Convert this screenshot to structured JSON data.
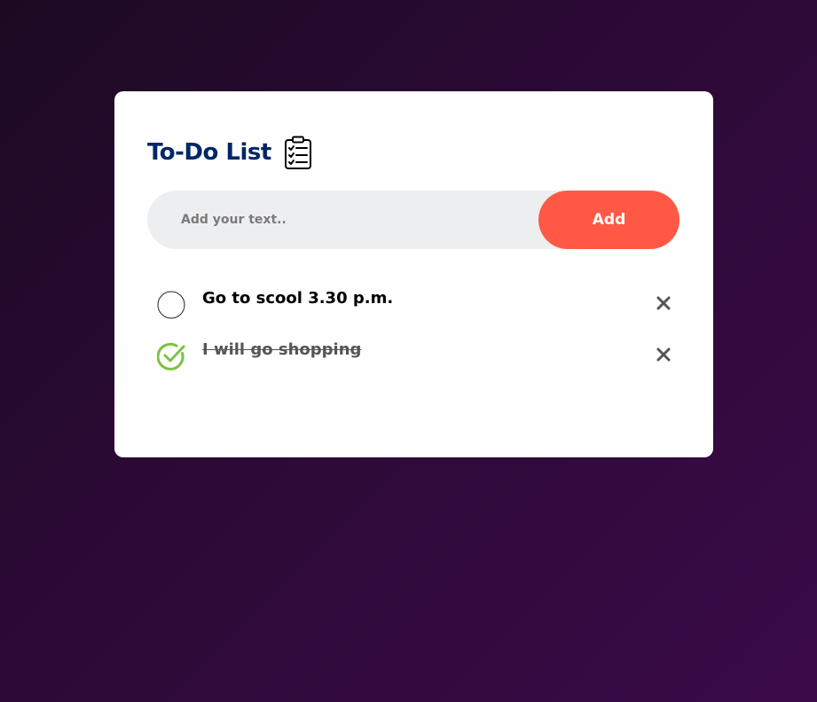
{
  "app": {
    "title": "To-Do List",
    "title_icon": "clipboard-checklist-icon"
  },
  "input": {
    "placeholder": "Add your text..",
    "value": ""
  },
  "add_button": {
    "label": "Add"
  },
  "colors": {
    "accent": "#ff5945",
    "title": "#002765",
    "check": "#7cc242",
    "input_bg": "#edeef0"
  },
  "tasks": [
    {
      "text": "Go to scool 3.30 p.m.",
      "done": false,
      "icon": "unchecked-circle-icon",
      "remove_icon": "close-icon"
    },
    {
      "text": "I will go shopping",
      "done": true,
      "icon": "checked-circle-icon",
      "remove_icon": "close-icon"
    }
  ]
}
